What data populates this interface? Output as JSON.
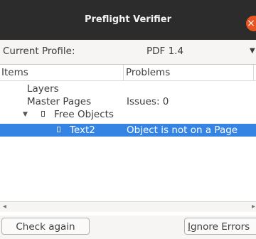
{
  "window": {
    "title": "Preflight Verifier"
  },
  "profile": {
    "label": "Current Profile:",
    "value": "PDF 1.4"
  },
  "columns": {
    "items": "Items",
    "problems": "Problems"
  },
  "rows": [
    {
      "item": "Layers",
      "problem": ""
    },
    {
      "item": "Master Pages",
      "problem": "Issues: 0"
    },
    {
      "item": "Free Objects",
      "problem": "",
      "expanded": true
    },
    {
      "item": "Text2",
      "problem": "Object is not on a Page",
      "selected": true
    }
  ],
  "buttons": {
    "check_again": "Check again",
    "ignore_errors_first": "I",
    "ignore_errors_rest": "gnore Errors"
  },
  "icons": {
    "close": "close-icon",
    "combo": "chevron-down-icon",
    "expander": "triangle-down-icon",
    "object": "text-frame-icon"
  },
  "colors": {
    "selection": "#3584e4",
    "close": "#e95420",
    "titlebar": "#2c2c2c"
  }
}
